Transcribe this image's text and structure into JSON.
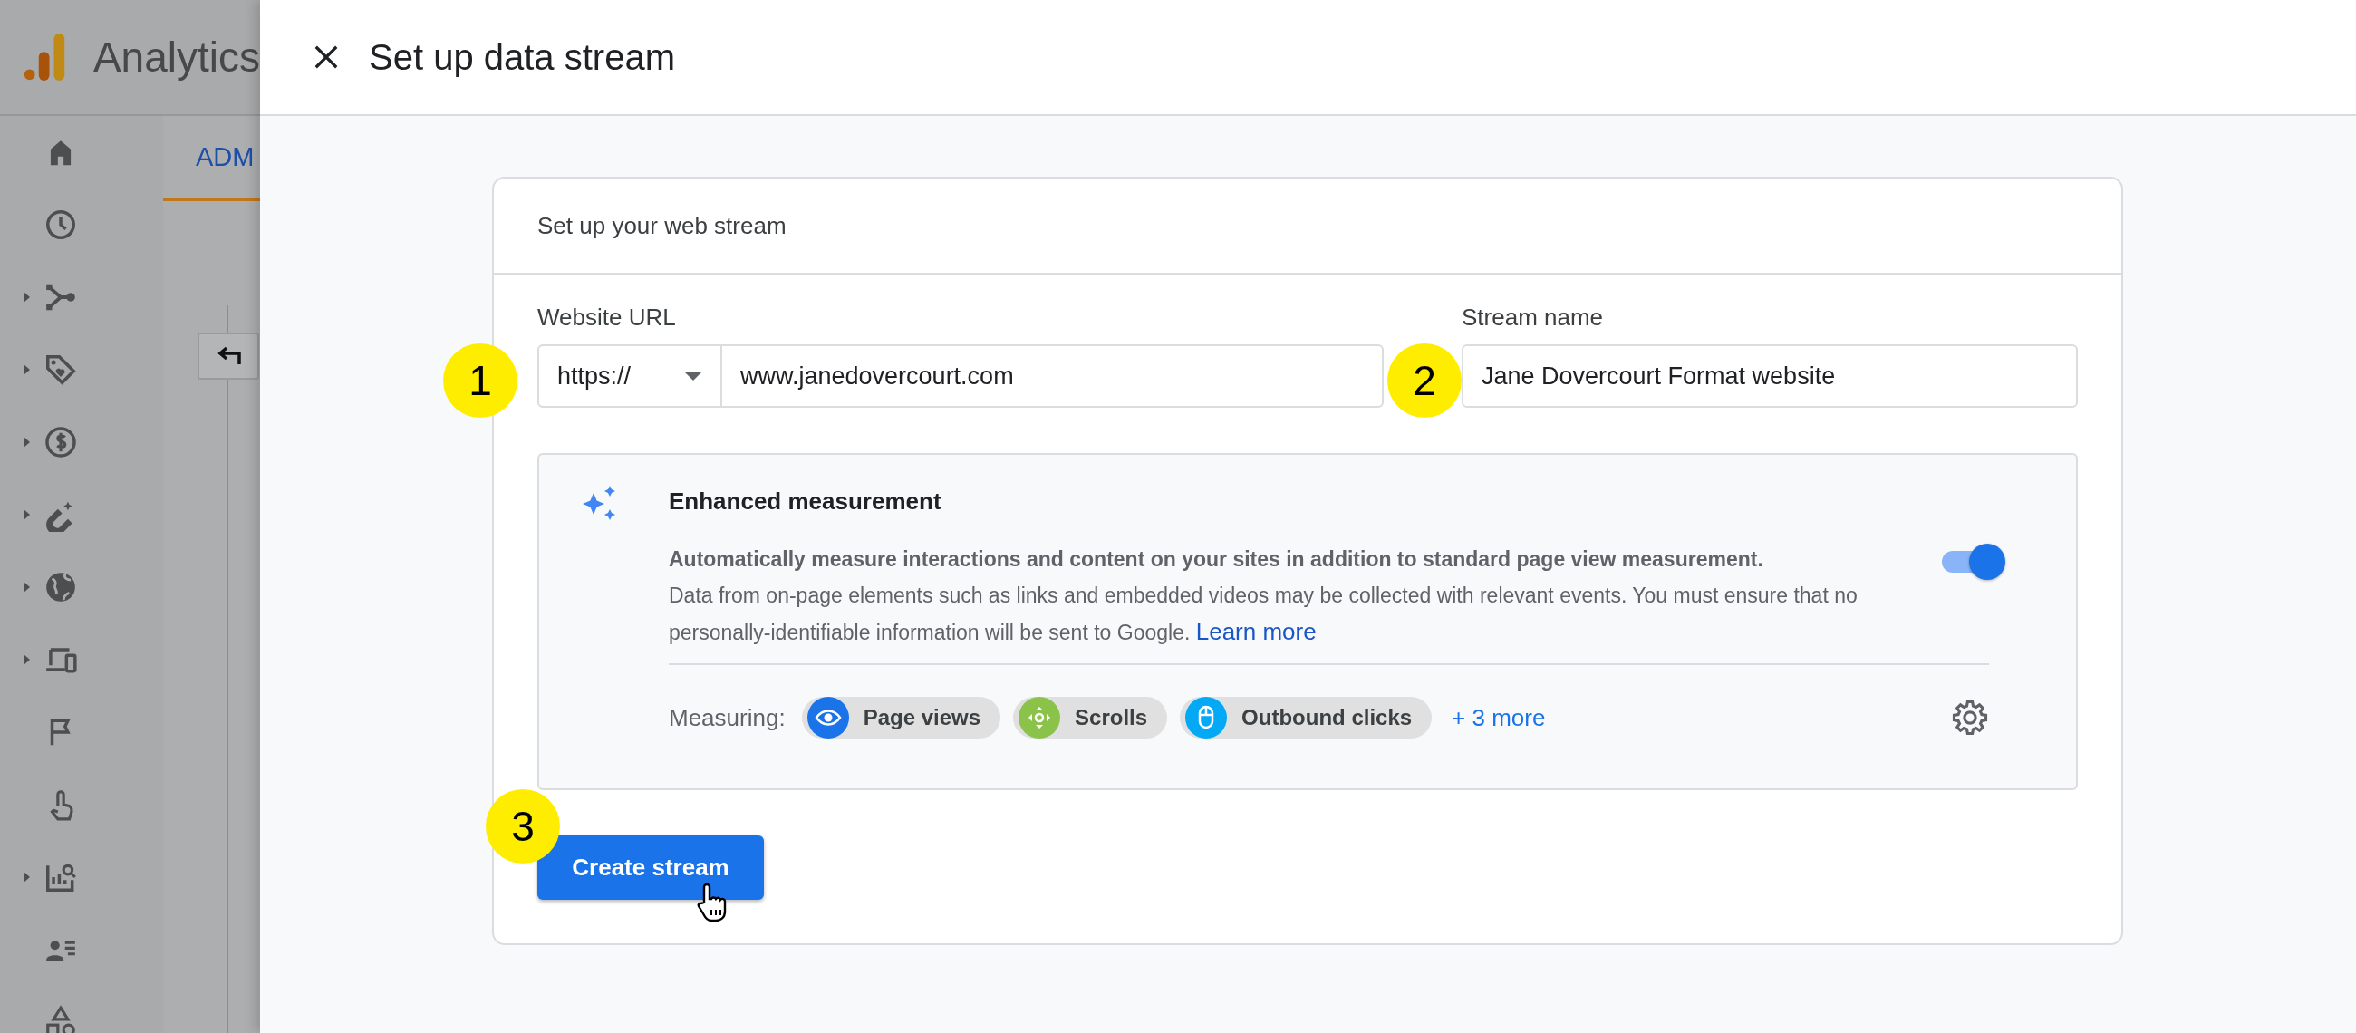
{
  "background_app": {
    "title": "Analytics",
    "tab": "ADM",
    "nav_items": [
      {
        "expandable": false
      },
      {
        "expandable": false
      },
      {
        "expandable": true
      },
      {
        "expandable": true
      },
      {
        "expandable": true
      },
      {
        "expandable": true
      },
      {
        "expandable": true
      },
      {
        "expandable": true
      },
      {
        "expandable": false
      },
      {
        "expandable": false
      },
      {
        "expandable": true
      },
      {
        "expandable": false
      },
      {
        "expandable": false
      }
    ]
  },
  "panel": {
    "title": "Set up data stream",
    "card": {
      "title": "Set up your web stream",
      "website_url": {
        "label": "Website URL",
        "protocol": "https://",
        "value": "www.janedovercourt.com"
      },
      "stream_name": {
        "label": "Stream name",
        "value": "Jane Dovercourt Format website"
      },
      "enhanced_measurement": {
        "title": "Enhanced measurement",
        "on": true,
        "summary": "Automatically measure interactions and content on your sites in addition to standard page view measurement.",
        "details": "Data from on-page elements such as links and embedded videos may be collected with relevant events. You must ensure that no personally-identifiable information will be sent to Google.",
        "learn_more": "Learn more",
        "measuring_label": "Measuring:",
        "chips": [
          {
            "label": "Page views",
            "color": "#1a73e8"
          },
          {
            "label": "Scrolls",
            "color": "#8bc34a"
          },
          {
            "label": "Outbound clicks",
            "color": "#03a9f4"
          }
        ],
        "more": "+ 3 more"
      },
      "create_button": "Create stream"
    }
  },
  "callouts": [
    "1",
    "2",
    "3"
  ]
}
